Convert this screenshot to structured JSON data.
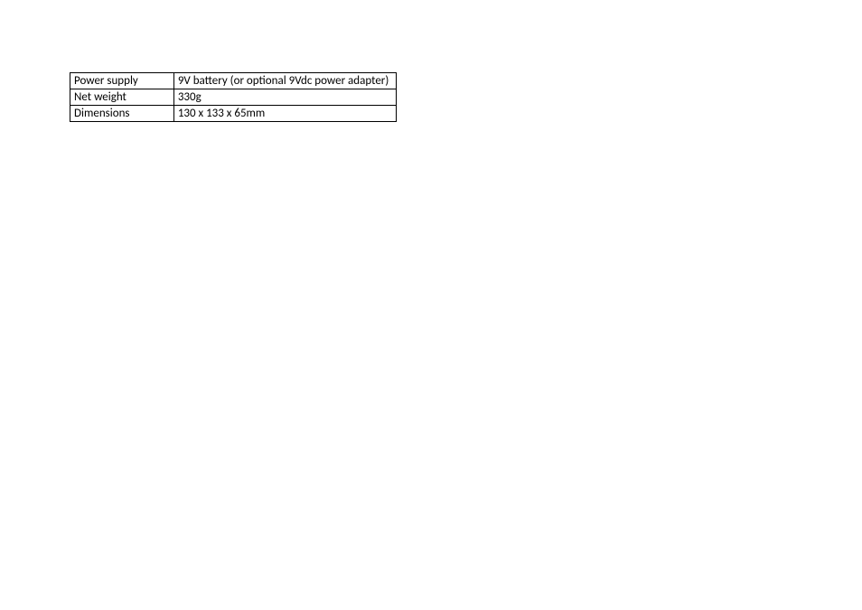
{
  "spec_table": {
    "rows": [
      {
        "label": "Power supply",
        "value": "9V battery (or optional 9Vdc power adapter)"
      },
      {
        "label": "Net weight",
        "value": "330g"
      },
      {
        "label": "Dimensions",
        "value": "130 x 133 x 65mm"
      }
    ]
  }
}
